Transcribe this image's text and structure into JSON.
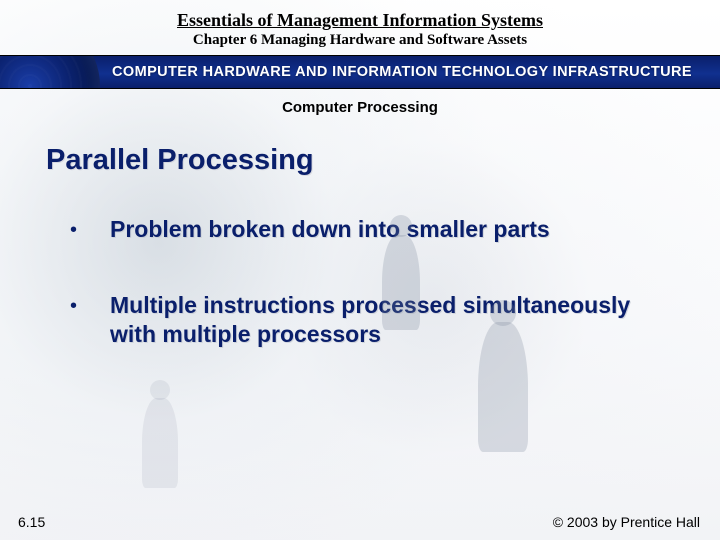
{
  "header": {
    "book_title": "Essentials of Management Information Systems",
    "chapter_line": "Chapter 6 Managing Hardware and Software Assets",
    "section_head": "COMPUTER HARDWARE AND INFORMATION TECHNOLOGY INFRASTRUCTURE",
    "topic": "Computer Processing"
  },
  "content": {
    "heading": "Parallel Processing",
    "bullets": [
      "Problem broken down into smaller parts",
      "Multiple instructions processed simultaneously with multiple processors"
    ]
  },
  "footer": {
    "slide_number": "6.15",
    "copyright": "© 2003 by Prentice Hall"
  }
}
